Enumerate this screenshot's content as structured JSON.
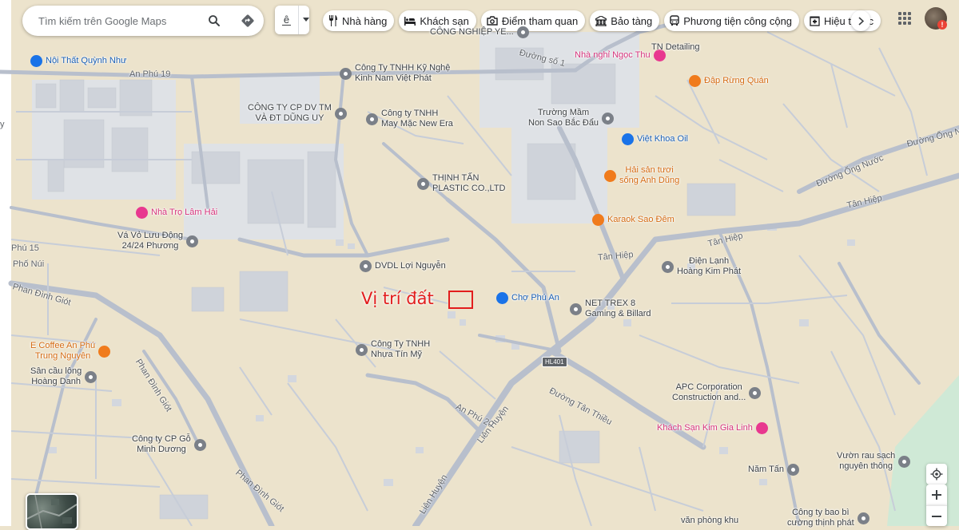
{
  "search": {
    "placeholder": "Tìm kiếm trên Google Maps"
  },
  "layer_button": {
    "label": "ê"
  },
  "chips": [
    {
      "label": "Nhà hàng",
      "icon": "fork-knife-icon"
    },
    {
      "label": "Khách sạn",
      "icon": "bed-icon"
    },
    {
      "label": "Điểm tham quan",
      "icon": "camera-icon"
    },
    {
      "label": "Bảo tàng",
      "icon": "museum-icon"
    },
    {
      "label": "Phương tiện công cộng",
      "icon": "bus-icon"
    },
    {
      "label": "Hiệu thuốc",
      "icon": "pharmacy-icon"
    }
  ],
  "annotation": {
    "text": "Vị trí đất",
    "color": "#e21d1d"
  },
  "highway_shield": "HL401",
  "places": [
    {
      "name": "Nội Thất Quỳnh Như",
      "kind": "blue"
    },
    {
      "name": "Công Ty TNHH Kỹ Nghệ\nKinh Nam Việt Phát",
      "kind": "gray"
    },
    {
      "name": "CÔNG TY CP DV TM\nVÀ ĐT DŨNG UY",
      "kind": "gray"
    },
    {
      "name": "Công ty TNHH\nMay Mặc New Era",
      "kind": "gray"
    },
    {
      "name": "THỊNH TẤN\nPLASTIC CO.,LTD",
      "kind": "gray"
    },
    {
      "name": "Nhà Trọ Lâm Hải",
      "kind": "pink"
    },
    {
      "name": "Vá Vỏ Lưu Động\n24/24 Phương",
      "kind": "gray"
    },
    {
      "name": "DVDL Lợi Nguyễn",
      "kind": "gray"
    },
    {
      "name": "Công Ty TNHH\nNhựa Tín Mỹ",
      "kind": "gray"
    },
    {
      "name": "E Coffee An Phú\nTrung Nguyên",
      "kind": "orange"
    },
    {
      "name": "Sân cầu lông\nHoàng Danh",
      "kind": "gray"
    },
    {
      "name": "Công ty CP Gỗ\nMinh Dương",
      "kind": "gray"
    },
    {
      "name": "Nhà nghỉ Ngọc Thu",
      "kind": "pink"
    },
    {
      "name": "Đập Rừng Quán",
      "kind": "orange"
    },
    {
      "name": "Trường Mầm\nNon Sao Bắc Đẩu",
      "kind": "gray"
    },
    {
      "name": "Việt Khoa Oil",
      "kind": "blue"
    },
    {
      "name": "Hải sản tươi\nsống Anh Dũng",
      "kind": "orange"
    },
    {
      "name": "Karaok Sao Đêm",
      "kind": "orange"
    },
    {
      "name": "Chợ Phú An",
      "kind": "blue"
    },
    {
      "name": "NET TREX 8\nGaming & Billard",
      "kind": "gray"
    },
    {
      "name": "Điện Lạnh\nHoàng Kim Phát",
      "kind": "gray"
    },
    {
      "name": "APC Corporation\nConstruction and...",
      "kind": "gray"
    },
    {
      "name": "Khách Sạn Kim Gia Linh",
      "kind": "pink"
    },
    {
      "name": "Vườn rau sạch\nnguyên thông",
      "kind": "gray"
    },
    {
      "name": "Năm Tấn",
      "kind": "gray"
    },
    {
      "name": "Công ty bao bì\ncường thịnh phát",
      "kind": "gray"
    },
    {
      "name": "CÔNG NGHIỆP YE...",
      "kind": "gray"
    },
    {
      "name": "TN Detailing",
      "kind": "gray"
    },
    {
      "name": "văn phòng khu",
      "kind": "gray"
    }
  ],
  "roads": [
    "An Phú 19",
    "Đường số 1",
    "Đường Ống Nư",
    "Đường Ống Nước",
    "Tân Hiệp",
    "Tân Hiệp",
    "Tân Hiệp",
    "Phú 15",
    "Phố Núi",
    "Phan Đình Giót",
    "Phan Đình Giót",
    "Phan Đình Giót",
    "An Phú 20",
    "Liên Huyện",
    "Liên Huyện",
    "Đường Tân Thiều",
    "y"
  ]
}
